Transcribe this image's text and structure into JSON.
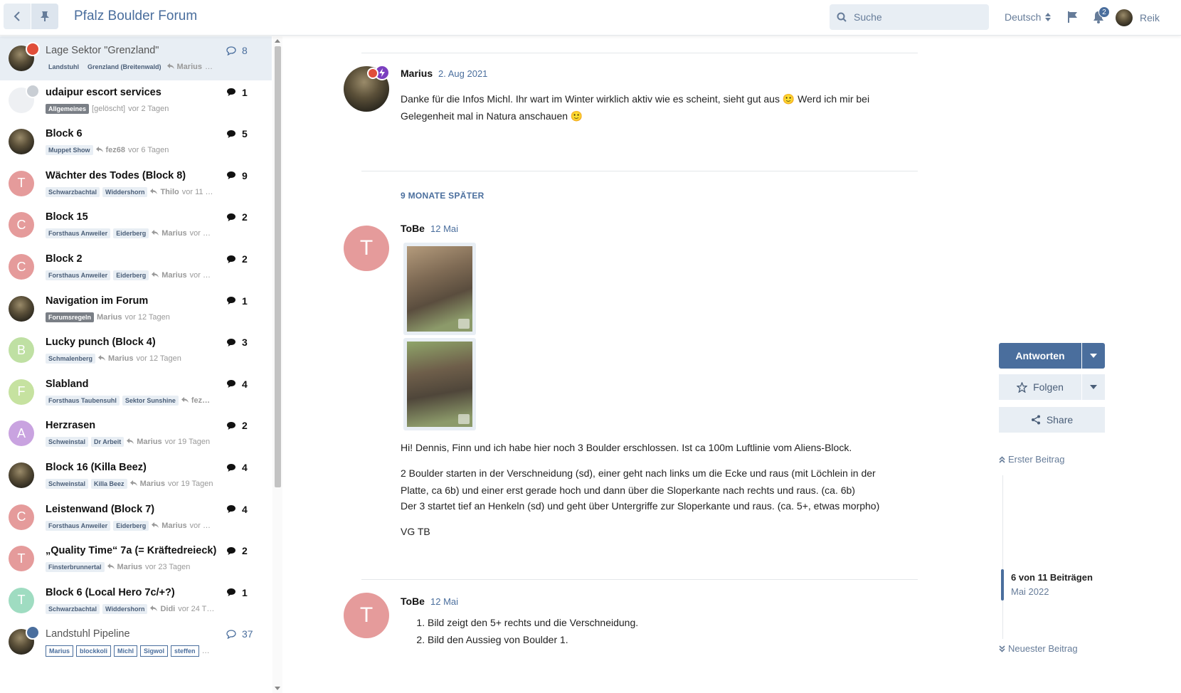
{
  "header": {
    "site_title": "Pfalz Boulder Forum",
    "search_placeholder": "Suche",
    "language": "Deutsch",
    "notifications_count": "2",
    "username": "Reik"
  },
  "topics": [
    {
      "title": "Lage Sektor \"Grenzland\"",
      "read": true,
      "active": true,
      "avatar": "photo",
      "badge_color": "#e04e39",
      "badge_icon": "pin-icon",
      "tags": [
        "Landstuhl",
        "Grenzland (Breitenwald)"
      ],
      "meta_user": "Marius",
      "meta_time": "…",
      "count": "8"
    },
    {
      "title": "udaipur escort services",
      "read": false,
      "avatar": "ghost",
      "badge_color": "#c9ced4",
      "badge_icon": "trash-icon",
      "tags": [
        "Allgemeines"
      ],
      "tag_style": "dark",
      "meta_prefix": "[gelöscht]",
      "meta_time": "vor 2 Tagen",
      "count": "1"
    },
    {
      "title": "Block 6",
      "avatar": "photo",
      "tags": [
        "Muppet Show"
      ],
      "meta_user": "fez68",
      "meta_time": "vor 6 Tagen",
      "count": "5"
    },
    {
      "title": "Wächter des Todes (Block 8)",
      "avatar": "T",
      "avatar_color": "#e59b9b",
      "tags": [
        "Schwarzbachtal",
        "Widdershorn"
      ],
      "meta_user": "Thilo",
      "meta_time": "vor 11 …",
      "count": "9"
    },
    {
      "title": "Block 15",
      "avatar": "C",
      "avatar_color": "#e59b9b",
      "tags": [
        "Forsthaus Anweiler",
        "Eiderberg"
      ],
      "meta_user": "Marius",
      "meta_time": "vor …",
      "count": "2"
    },
    {
      "title": "Block 2",
      "avatar": "C",
      "avatar_color": "#e59b9b",
      "tags": [
        "Forsthaus Anweiler",
        "Eiderberg"
      ],
      "meta_user": "Marius",
      "meta_time": "vor …",
      "count": "2"
    },
    {
      "title": "Navigation im Forum",
      "avatar": "photo",
      "tags": [
        "Forumsregeln"
      ],
      "tag_style": "dark",
      "meta_user": "Marius",
      "meta_time": "vor 12 Tagen",
      "no_reply_icon": true,
      "count": "1"
    },
    {
      "title": "Lucky punch (Block 4)",
      "avatar": "B",
      "avatar_color": "#bfe0a3",
      "tags": [
        "Schmalenberg"
      ],
      "meta_user": "Marius",
      "meta_time": "vor 12 Tagen",
      "count": "3"
    },
    {
      "title": "Slabland",
      "avatar": "F",
      "avatar_color": "#c6e2a0",
      "tags": [
        "Forsthaus Taubensuhl",
        "Sektor Sunshine"
      ],
      "meta_user": "fez…",
      "meta_time": "",
      "count": "4"
    },
    {
      "title": "Herzrasen",
      "avatar": "A",
      "avatar_color": "#c9a3e0",
      "tags": [
        "Schweinstal",
        "Dr Arbeit"
      ],
      "meta_user": "Marius",
      "meta_time": "vor 19 Tagen",
      "count": "2"
    },
    {
      "title": "Block 16 (Killa Beez)",
      "avatar": "photo",
      "tags": [
        "Schweinstal",
        "Killa Beez"
      ],
      "meta_user": "Marius",
      "meta_time": "vor 19 Tagen",
      "count": "4"
    },
    {
      "title": "Leistenwand (Block 7)",
      "avatar": "C",
      "avatar_color": "#e59b9b",
      "tags": [
        "Forsthaus Anweiler",
        "Eiderberg"
      ],
      "meta_user": "Marius",
      "meta_time": "vor …",
      "count": "4"
    },
    {
      "title": "„Quality Time“ 7a (= Kräftedreieck)",
      "avatar": "T",
      "avatar_color": "#e59b9b",
      "tags": [
        "Finsterbrunnertal"
      ],
      "meta_user": "Marius",
      "meta_time": "vor 23 Tagen",
      "count": "2"
    },
    {
      "title": "Block 6 (Local Hero 7c/+?)",
      "avatar": "T",
      "avatar_color": "#9fdcc1",
      "tags": [
        "Schwarzbachtal",
        "Widdershorn"
      ],
      "meta_user": "Didi",
      "meta_time": "vor 24 T…",
      "count": "1"
    },
    {
      "title": "Landstuhl Pipeline",
      "read": true,
      "avatar": "photo",
      "badge_color": "#4a6e9d",
      "badge_icon": "chat-icon",
      "tags": [
        "Marius",
        "blockkoli",
        "Michl",
        "Sigwol",
        "steffen"
      ],
      "tag_style": "outline",
      "meta_time": "…",
      "count": "37"
    }
  ],
  "posts": [
    {
      "author": "Marius",
      "date": "2. Aug 2021",
      "avatar": "photo",
      "text": "Danke für die Infos Michl. Ihr wart im Winter wirklich aktiv wie es scheint, sieht gut aus 🙂 Werd ich mir bei Gelegenheit mal in Natura anschauen 🙂"
    },
    {
      "author": "ToBe",
      "date": "12 Mai",
      "avatar": "T",
      "paragraphs": [
        "Hi! Dennis, Finn und ich habe hier noch 3 Boulder erschlossen. Ist ca 100m Luftlinie vom Aliens-Block.",
        "2 Boulder starten in der Verschneidung (sd), einer geht nach links um die Ecke und raus (mit Löchlein in der Platte, ca 6b) und einer erst gerade hoch und dann über die Sloperkante nach rechts und raus. (ca. 6b)",
        "Der 3 startet tief an Henkeln (sd) und geht über Untergriffe zur Sloperkante und raus. (ca. 5+, etwas morpho)",
        "VG TB"
      ]
    },
    {
      "author": "ToBe",
      "date": "12 Mai",
      "avatar": "T",
      "list": [
        "Bild zeigt den 5+ rechts und die Verschneidung.",
        "Bild den Aussieg von Boulder 1."
      ]
    }
  ],
  "gap_label": "9 MONATE SPÄTER",
  "timeline": {
    "reply_label": "Antworten",
    "follow_label": "Folgen",
    "share_label": "Share",
    "first_post": "Erster Beitrag",
    "position": "6 von 11 Beiträgen",
    "position_date": "Mai 2022",
    "newest_post": "Neuester Beitrag"
  },
  "colors": {
    "accent": "#4a6e9d",
    "pin_badge": "#e04e39",
    "tobe_avatar": "#e59b9b"
  }
}
